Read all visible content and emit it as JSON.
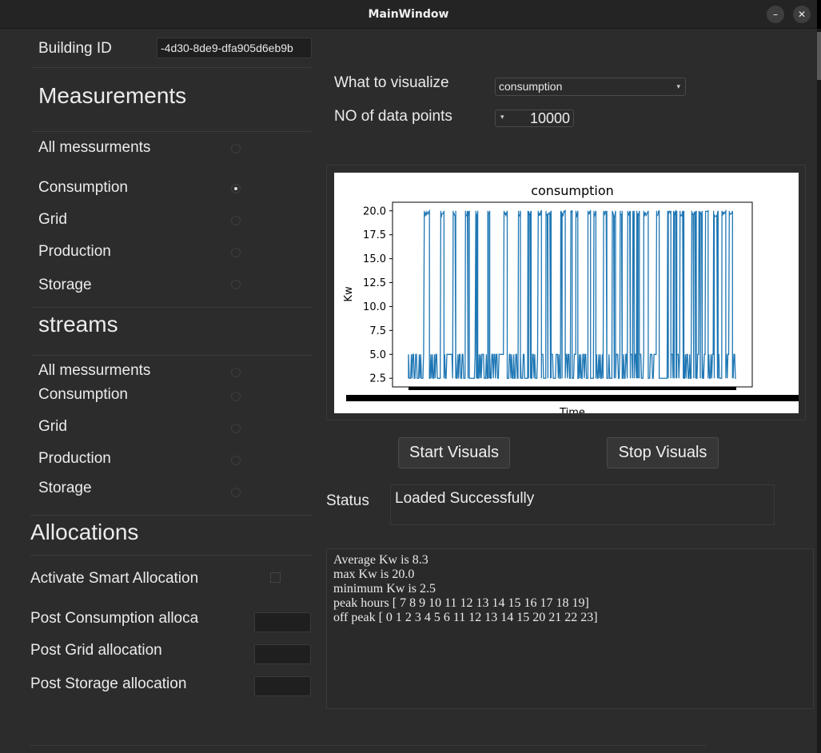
{
  "window": {
    "title": "MainWindow",
    "minimize_glyph": "–",
    "close_glyph": "✕"
  },
  "building": {
    "label": "Building ID",
    "value": "-4d30-8de9-dfa905d6eb9b"
  },
  "measurements": {
    "heading": "Measurements",
    "options": [
      {
        "label": "All messurments",
        "checked": false
      },
      {
        "label": "Consumption",
        "checked": true
      },
      {
        "label": "Grid",
        "checked": false
      },
      {
        "label": "Production",
        "checked": false
      },
      {
        "label": "Storage",
        "checked": false
      }
    ]
  },
  "streams": {
    "heading": "streams",
    "options": [
      {
        "label": "All messurments",
        "checked": false
      },
      {
        "label": "Consumption",
        "checked": false
      },
      {
        "label": "Grid",
        "checked": false
      },
      {
        "label": "Production",
        "checked": false
      },
      {
        "label": "Storage",
        "checked": false
      }
    ]
  },
  "allocations": {
    "heading": "Allocations",
    "smart_label": "Activate Smart Allocation",
    "smart_checked": false,
    "posts": [
      {
        "label": "Post  Consumption alloca",
        "value": ""
      },
      {
        "label": "Post  Grid allocation",
        "value": ""
      },
      {
        "label": "Post  Storage allocation",
        "value": ""
      }
    ]
  },
  "controls": {
    "visualize_label": "What to visualize",
    "visualize_value": "consumption",
    "points_label": "NO of data points",
    "points_value": "10000",
    "dropdown_glyph": "▾"
  },
  "buttons": {
    "start": "Start Visuals",
    "stop": "Stop Visuals"
  },
  "status": {
    "label": "Status",
    "value": "Loaded Successfully"
  },
  "info_lines": [
    "Average Kw is 8.3",
    "max Kw is 20.0",
    "minimum Kw is 2.5",
    "peak hours [ 7  8  9 10 11 12 13 14 15 16 17 18 19]",
    "off peak [ 0  1  2  3  4  5  6 11 12 13 14 15 20 21 22 23]"
  ],
  "chart_data": {
    "type": "line",
    "title": "consumption",
    "xlabel": "Time",
    "ylabel": "Kw",
    "ylim": [
      1.6,
      20.9
    ],
    "yticks": [
      2.5,
      5.0,
      7.5,
      10.0,
      12.5,
      15.0,
      17.5,
      20.0
    ],
    "ytick_labels": [
      "2.5",
      "5.0",
      "7.5",
      "10.0",
      "12.5",
      "15.0",
      "17.5",
      "20.0"
    ],
    "grid": false,
    "line_color": "#1f77b4",
    "levels": {
      "low": 2.5,
      "mid": 5.0,
      "peak": 20.0
    },
    "series": [
      {
        "n_points": 10000,
        "values_summary": {
          "min": 2.5,
          "max": 20.0,
          "mean": 8.3
        }
      }
    ]
  }
}
